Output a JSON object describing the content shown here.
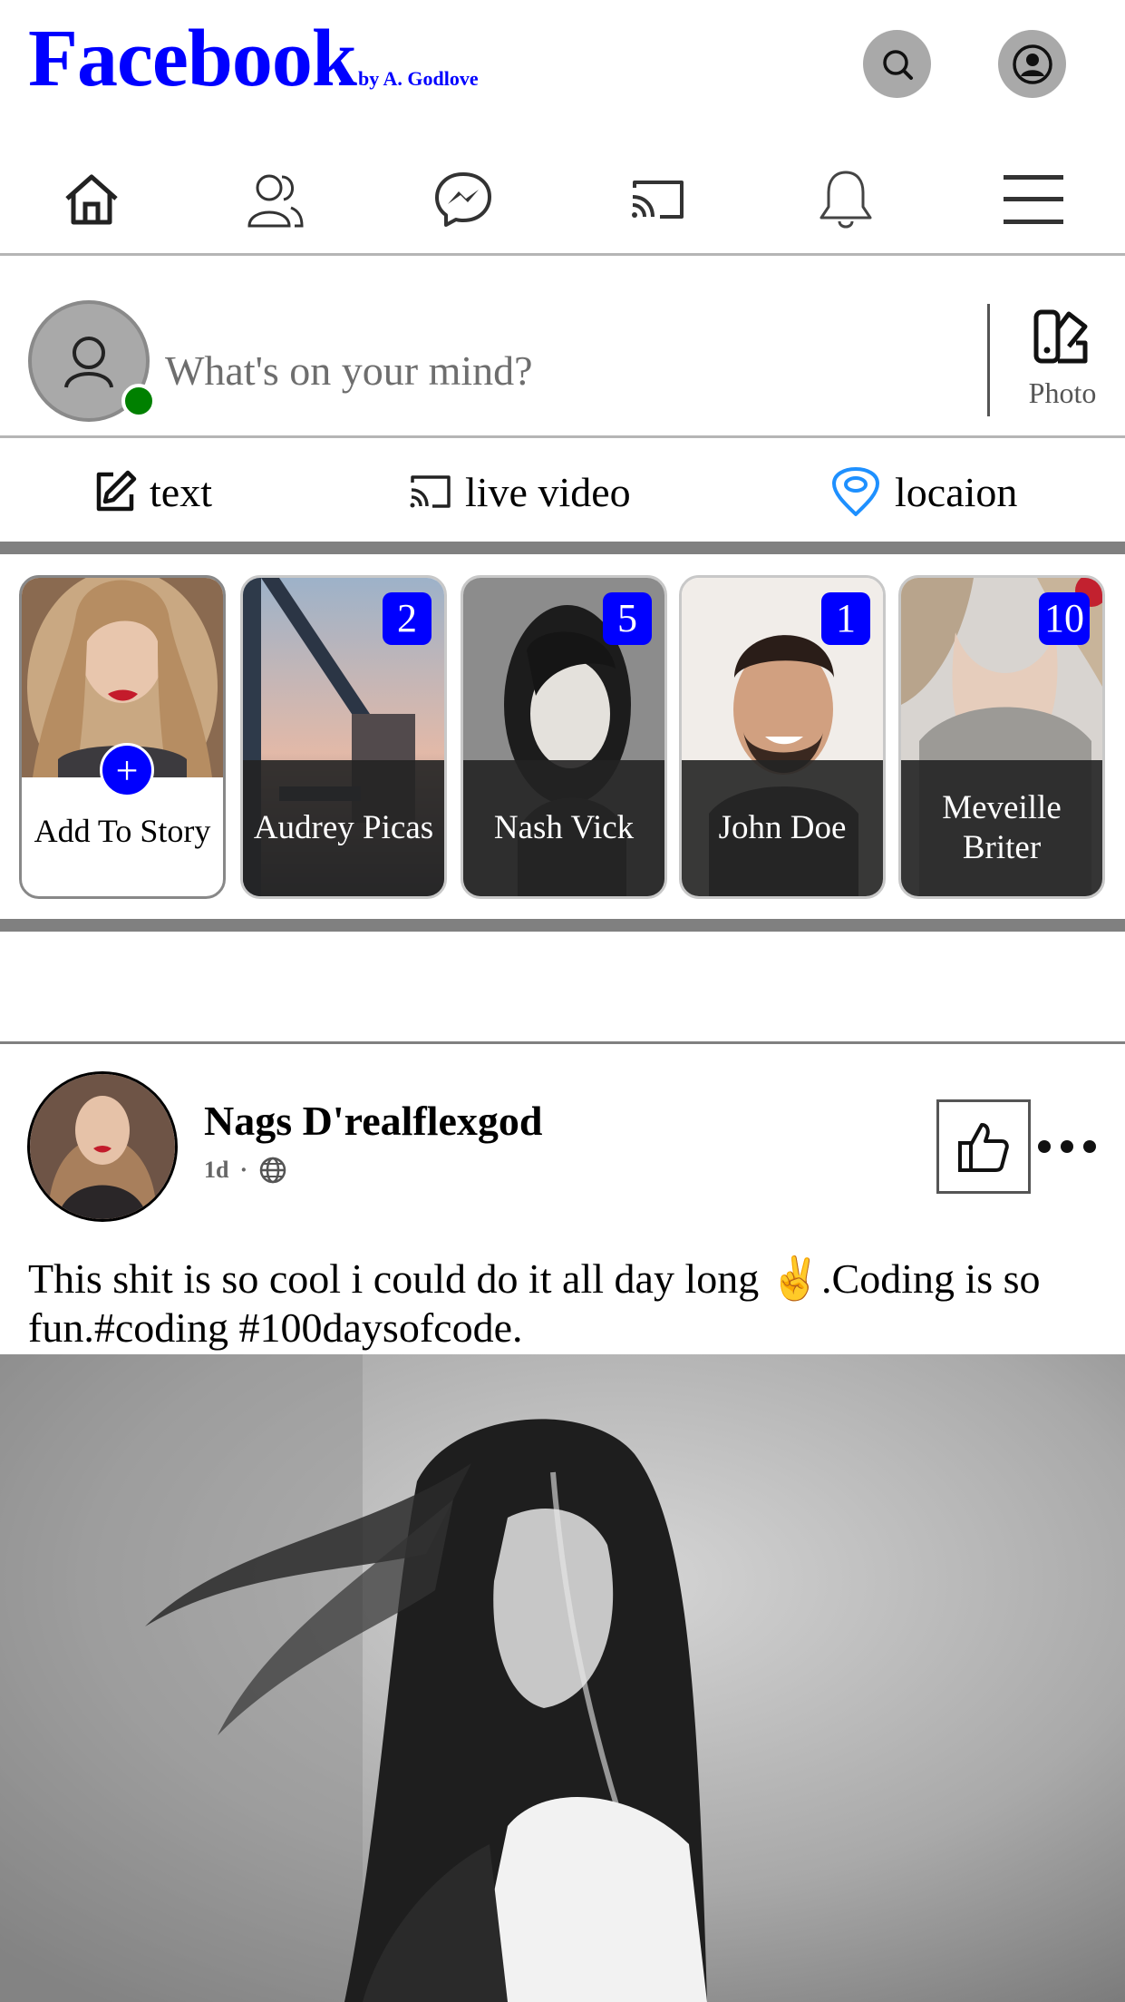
{
  "header": {
    "title": "Facebook",
    "subtitle": "by A. Godlove",
    "search_icon": "search-icon",
    "profile_icon": "user-circle-icon",
    "accent": "#0000ff"
  },
  "nav": {
    "items": [
      "home-icon",
      "friends-icon",
      "messenger-icon",
      "watch-cast-icon",
      "notifications-bell-icon",
      "menu-icon"
    ]
  },
  "composer": {
    "placeholder": "What's on your mind?",
    "photo_label": "Photo",
    "online_color": "#008000"
  },
  "actions": {
    "text_label": "text",
    "live_label": "live video",
    "location_label": "locaion"
  },
  "stories": {
    "add_label": "Add To Story",
    "plus": "+",
    "items": [
      {
        "name": "Audrey Picas",
        "count": "2"
      },
      {
        "name": "Nash Vick",
        "count": "5"
      },
      {
        "name": "John Doe",
        "count": "1"
      },
      {
        "name": "Meveille Briter",
        "count": "10"
      }
    ]
  },
  "post": {
    "author": "Nags D'realflexgod",
    "time": "1d",
    "dot": "·",
    "text": "This shit is so cool i could do it all day long ✌️.Coding is so fun.#coding #100daysofcode."
  }
}
